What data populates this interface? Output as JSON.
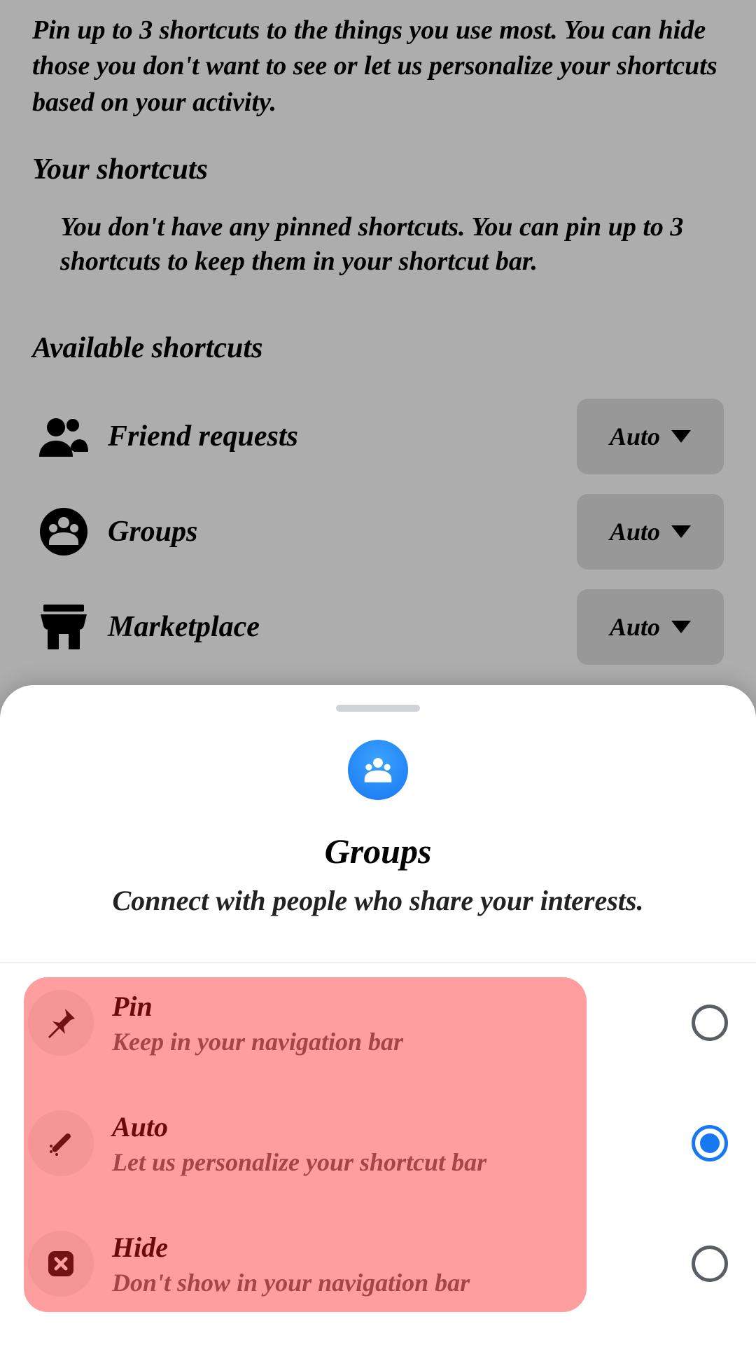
{
  "intro": "Pin up to 3 shortcuts to the things you use most. You can hide those you don't want to see or let us personalize your shortcuts based on your activity.",
  "your_shortcuts_h": "Your shortcuts",
  "empty_msg": "You don't have any pinned shortcuts. You can pin up to 3 shortcuts to keep them in your shortcut bar.",
  "available_h": "Available shortcuts",
  "shortcuts": [
    {
      "label": "Friend requests",
      "button": "Auto",
      "icon": "friends"
    },
    {
      "label": "Groups",
      "button": "Auto",
      "icon": "groups"
    },
    {
      "label": "Marketplace",
      "button": "Auto",
      "icon": "store"
    }
  ],
  "sheet": {
    "title": "Groups",
    "subtitle": "Connect with people who share your interests.",
    "options": [
      {
        "title": "Pin",
        "sub": "Keep in your navigation bar",
        "icon": "pin",
        "selected": false
      },
      {
        "title": "Auto",
        "sub": "Let us personalize your shortcut bar",
        "icon": "wand",
        "selected": true
      },
      {
        "title": "Hide",
        "sub": "Don't show in your navigation bar",
        "icon": "hide",
        "selected": false
      }
    ]
  }
}
